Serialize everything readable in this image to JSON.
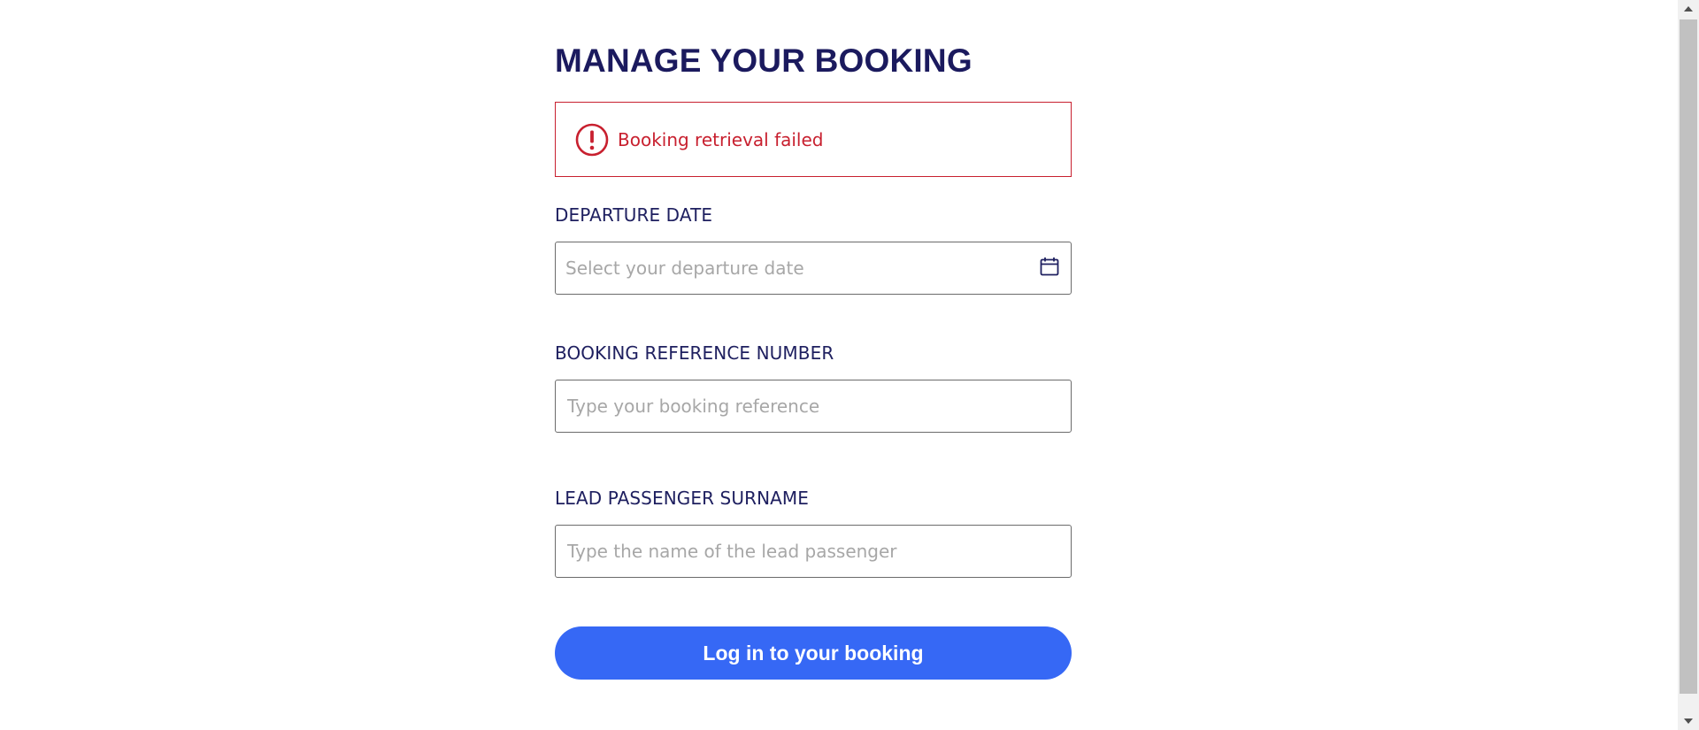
{
  "page": {
    "title": "MANAGE YOUR BOOKING"
  },
  "alert": {
    "icon": "exclamation-circle-icon",
    "message": "Booking retrieval failed",
    "color": "#c8202f"
  },
  "form": {
    "departure_date": {
      "label": "DEPARTURE DATE",
      "placeholder": "Select your departure date",
      "value": "",
      "icon": "calendar-icon"
    },
    "booking_reference": {
      "label": "BOOKING REFERENCE NUMBER",
      "placeholder": "Type your booking reference",
      "value": ""
    },
    "lead_surname": {
      "label": "LEAD PASSENGER SURNAME",
      "placeholder": "Type the name of the lead passenger",
      "value": ""
    },
    "submit_label": "Log in to your booking"
  },
  "colors": {
    "heading": "#1b1a5e",
    "error": "#c8202f",
    "button": "#3668f5"
  }
}
